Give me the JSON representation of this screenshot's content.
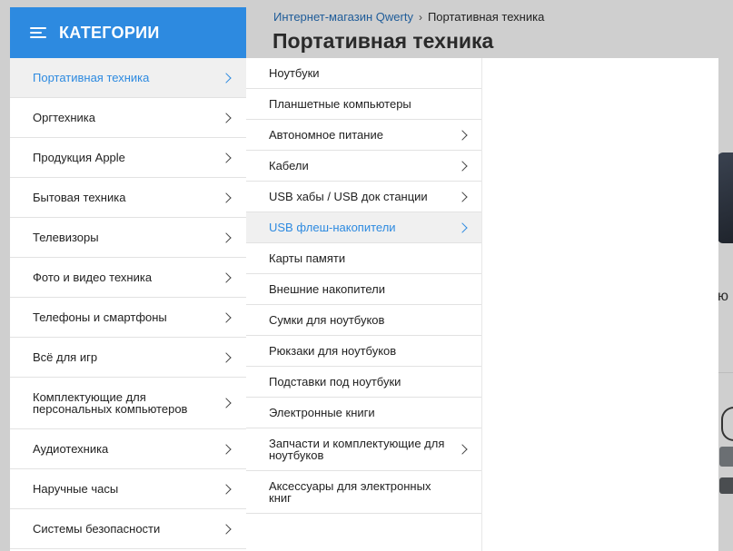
{
  "header": {
    "categories_title": "КАТЕГОРИИ",
    "menu_icon": "hamburger-menu-icon",
    "accent_color": "#2d8ae0"
  },
  "breadcrumb": {
    "home": "Интернет-магазин Qwerty",
    "current": "Портативная техника"
  },
  "page_title": "Портативная техника",
  "background_fragment": "ю",
  "categories": [
    {
      "label": "Портативная техника",
      "active": true
    },
    {
      "label": "Оргтехника"
    },
    {
      "label": "Продукция Apple"
    },
    {
      "label": "Бытовая техника"
    },
    {
      "label": "Телевизоры"
    },
    {
      "label": "Фото и видео техника"
    },
    {
      "label": "Телефоны и смартфоны"
    },
    {
      "label": "Всё для игр"
    },
    {
      "label": "Комплектующие для персональных компьютеров"
    },
    {
      "label": "Аудиотехника"
    },
    {
      "label": "Наручные часы"
    },
    {
      "label": "Системы безопасности"
    }
  ],
  "subcategories": [
    {
      "label": "Ноутбуки",
      "has_children": false
    },
    {
      "label": "Планшетные компьютеры",
      "has_children": false
    },
    {
      "label": "Автономное питание",
      "has_children": true
    },
    {
      "label": "Кабели",
      "has_children": true
    },
    {
      "label": "USB хабы / USB док станции",
      "has_children": true
    },
    {
      "label": "USB флеш-накопители",
      "has_children": true,
      "active": true
    },
    {
      "label": "Карты памяти",
      "has_children": false
    },
    {
      "label": "Внешние накопители",
      "has_children": false
    },
    {
      "label": "Сумки для ноутбуков",
      "has_children": false
    },
    {
      "label": "Рюкзаки для ноутбуков",
      "has_children": false
    },
    {
      "label": "Подставки под ноутбуки",
      "has_children": false
    },
    {
      "label": "Электронные книги",
      "has_children": false
    },
    {
      "label": "Запчасти и комплектующие для ноутбуков",
      "has_children": true
    },
    {
      "label": "Аксессуары для электронных книг",
      "has_children": false
    }
  ]
}
